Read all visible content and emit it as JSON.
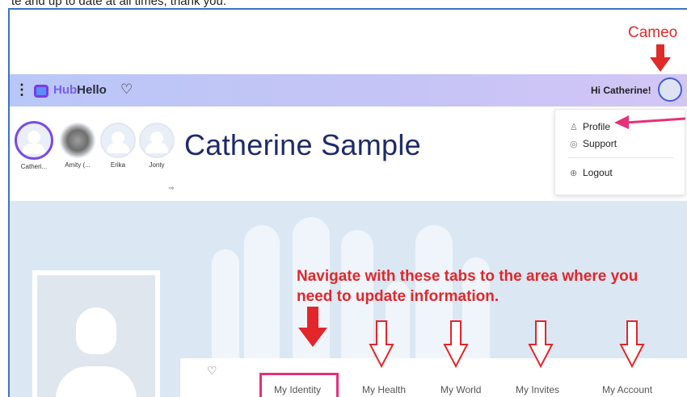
{
  "caption": "te and up to date at all times, thank you.",
  "annotation": {
    "cameo_label": "Cameo",
    "instruction": "Navigate with these tabs to the area where you need to update information."
  },
  "nav": {
    "brand_prefix": "Hub",
    "brand_suffix": "Hello",
    "greeting": "Hi Catherine!"
  },
  "menu": {
    "items": [
      {
        "label": "Profile",
        "icon": "person-icon"
      },
      {
        "label": "Support",
        "icon": "support-icon"
      },
      {
        "label": "Logout",
        "icon": "logout-icon"
      }
    ]
  },
  "people": [
    {
      "name": "Catheri..."
    },
    {
      "name": "Amity (..."
    },
    {
      "name": "Erika"
    },
    {
      "name": "Jonty"
    }
  ],
  "profile": {
    "first_name": "Catherine",
    "last_name": "Sample"
  },
  "tabs": [
    {
      "label": "My Identity"
    },
    {
      "label": "My Health"
    },
    {
      "label": "My World"
    },
    {
      "label": "My Invites"
    },
    {
      "label": "My Account"
    }
  ],
  "colors": {
    "accent": "#7a4be6",
    "annotation_red": "#e3262a",
    "highlight_pink": "#e5307a",
    "name_navy": "#1f2a6b"
  }
}
